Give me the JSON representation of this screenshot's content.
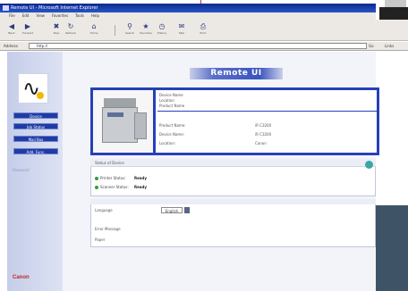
{
  "window": {
    "title": "Remote UI - Microsoft Internet Explorer"
  },
  "menubar": [
    "File",
    "Edit",
    "View",
    "Favorites",
    "Tools",
    "Help"
  ],
  "toolbar": {
    "buttons": [
      "Back",
      "Forward",
      "Stop",
      "Refresh",
      "Home",
      "Search",
      "Favorites",
      "History",
      "Mail",
      "Print"
    ]
  },
  "address": {
    "label": "Address",
    "url": "http://",
    "go": "Go",
    "links": "Links"
  },
  "banner": "Remote UI",
  "sidebar": {
    "buttons": [
      "Device",
      "Job Status",
      "Mail Box",
      "Add. Func."
    ],
    "link": "Password",
    "brand": "Canon"
  },
  "device": {
    "name_lines": [
      "Device Name",
      "Location",
      "Product Name"
    ],
    "rows": [
      {
        "label": "Product Name:",
        "value": "iR C3200"
      },
      {
        "label": "Device Name:",
        "value": "iR C3200"
      },
      {
        "label": "Location:",
        "value": "Canon"
      }
    ]
  },
  "status": {
    "header": "Status of Device",
    "items": [
      {
        "label": "Printer Status:",
        "value": "Ready"
      },
      {
        "label": "Scanner Status:",
        "value": "Ready"
      }
    ]
  },
  "info": {
    "rows": [
      "Language",
      "Error Message",
      "Paper"
    ],
    "language_value": "English"
  },
  "colors": {
    "accent": "#2640b8",
    "nav": "#1f3ba8",
    "ready": "#2f9e3c",
    "brand": "#bb2a2a"
  }
}
